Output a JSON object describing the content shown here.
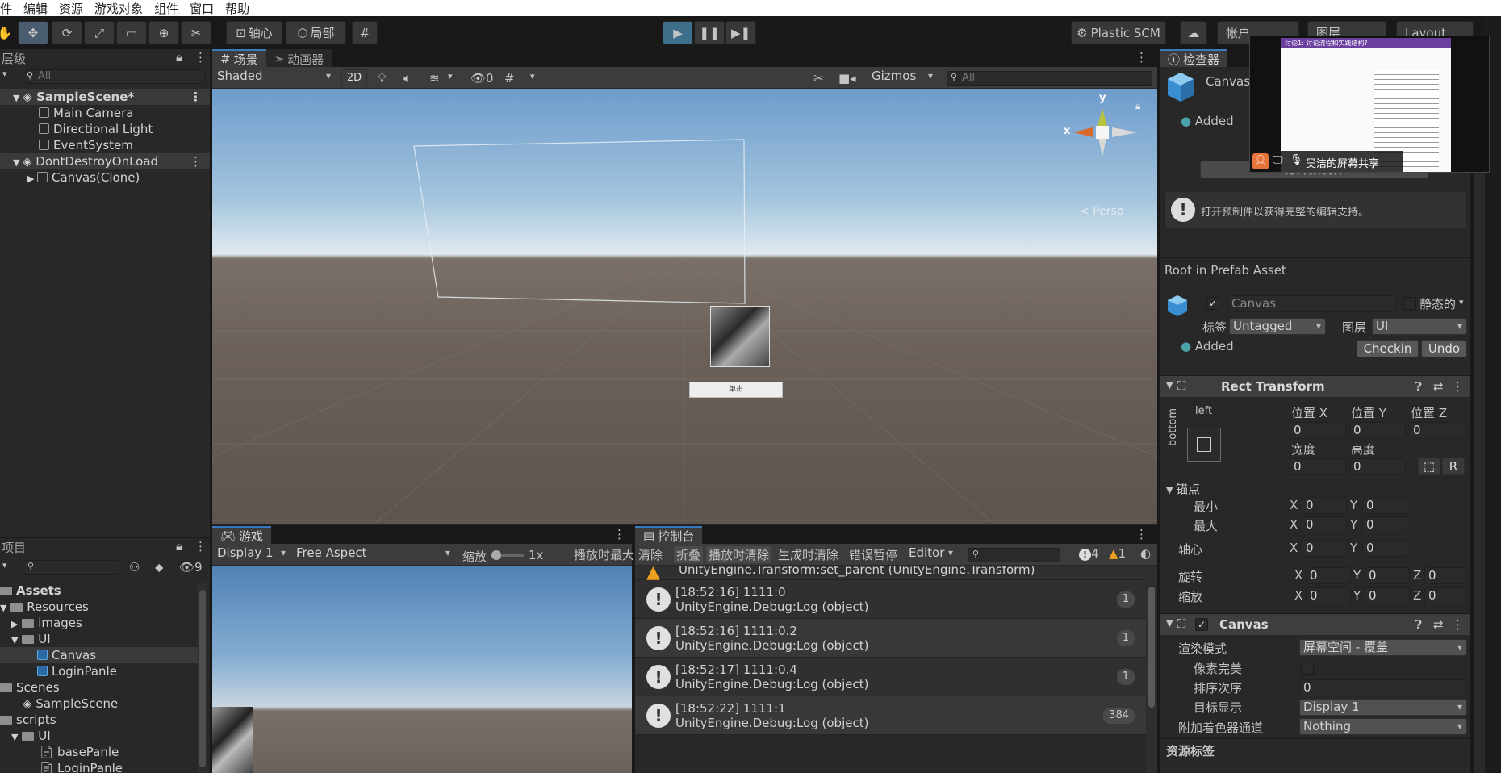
{
  "menu": {
    "items": [
      "件",
      "编辑",
      "资源",
      "游戏对象",
      "组件",
      "窗口",
      "帮助"
    ]
  },
  "toolbar": {
    "pivot": "轴心",
    "local": "局部",
    "plastic": "Plastic SCM",
    "account": "帐户",
    "layers": "图层",
    "layout": "Layout"
  },
  "hierarchy": {
    "tab": "层级",
    "search_placeholder": "All",
    "rows": [
      {
        "label": "SampleScene*",
        "type": "scene"
      },
      {
        "label": "Main Camera",
        "type": "go"
      },
      {
        "label": "Directional Light",
        "type": "go"
      },
      {
        "label": "EventSystem",
        "type": "go"
      },
      {
        "label": "DontDestroyOnLoad",
        "type": "scene"
      },
      {
        "label": "Canvas(Clone)",
        "type": "go"
      }
    ]
  },
  "scene": {
    "tab_scene": "场景",
    "tab_animator": "动画器",
    "shading": "Shaded",
    "mode2d": "2D",
    "hidden_count": "0",
    "gizmos": "Gizmos",
    "search_placeholder": "All",
    "axis_y": "y",
    "axis_x": "x",
    "persp": "< Persp",
    "button_caption": "单击"
  },
  "game": {
    "tab": "游戏",
    "display": "Display 1",
    "aspect": "Free Aspect",
    "scale_label": "缩放",
    "scale_value": "1x",
    "maximize": "播放时最大"
  },
  "console": {
    "tab": "控制台",
    "clear": "清除",
    "collapse": "折叠",
    "clear_on_play": "播放时清除",
    "clear_on_build": "生成时清除",
    "error_pause": "错误暂停",
    "editor": "Editor",
    "count_info": "4",
    "count_warn": "1",
    "top_line": "UnityEngine.Transform:set_parent (UnityEngine.Transform)",
    "rows": [
      {
        "line1": "[18:52:16] 1111:0",
        "line2": "UnityEngine.Debug:Log (object)",
        "count": "1"
      },
      {
        "line1": "[18:52:16] 1111:0.2",
        "line2": "UnityEngine.Debug:Log (object)",
        "count": "1"
      },
      {
        "line1": "[18:52:17] 1111:0.4",
        "line2": "UnityEngine.Debug:Log (object)",
        "count": "1"
      },
      {
        "line1": "[18:52:22] 1111:1",
        "line2": "UnityEngine.Debug:Log (object)",
        "count": "384"
      }
    ]
  },
  "project": {
    "tab": "项目",
    "hidden_count": "9",
    "tree": [
      {
        "label": "Assets",
        "indent": 0,
        "kind": "folder"
      },
      {
        "label": "Resources",
        "indent": 1,
        "kind": "folder"
      },
      {
        "label": "images",
        "indent": 2,
        "kind": "folder"
      },
      {
        "label": "UI",
        "indent": 2,
        "kind": "folder"
      },
      {
        "label": "Canvas",
        "indent": 3,
        "kind": "prefab"
      },
      {
        "label": "LoginPanle",
        "indent": 3,
        "kind": "prefab"
      },
      {
        "label": "Scenes",
        "indent": 0,
        "kind": "folder"
      },
      {
        "label": "SampleScene",
        "indent": 1,
        "kind": "scene"
      },
      {
        "label": "scripts",
        "indent": 0,
        "kind": "folder"
      },
      {
        "label": "UI",
        "indent": 1,
        "kind": "folder"
      },
      {
        "label": "basePanle",
        "indent": 2,
        "kind": "script"
      },
      {
        "label": "LoginPanle",
        "indent": 2,
        "kind": "script"
      }
    ]
  },
  "inspector": {
    "tab": "检查器",
    "object_name": "Canvas",
    "added": "Added",
    "open_prefab_btn": "打开预制件",
    "help_text": "打开预制件以获得完整的编辑支持。",
    "root_label": "Root in Prefab Asset",
    "name_field": "Canvas",
    "static_label": "静态的",
    "tag_label": "标签",
    "tag_value": "Untagged",
    "layer_label": "图层",
    "layer_value": "UI",
    "added2": "Added",
    "checkin": "Checkin",
    "undo": "Undo",
    "rect": {
      "title": "Rect Transform",
      "anchor_h": "left",
      "anchor_v": "bottom",
      "pos_x": "位置 X",
      "pos_y": "位置 Y",
      "pos_z": "位置 Z",
      "width": "宽度",
      "height": "高度",
      "v_px": "0",
      "v_py": "0",
      "v_pz": "0",
      "v_w": "0",
      "v_h": "0",
      "anchors": "锚点",
      "min": "最小",
      "max": "最大",
      "pivot": "轴心",
      "rotation": "旋转",
      "scale": "缩放",
      "x": "X",
      "y": "Y",
      "z": "Z",
      "zero": "0"
    },
    "canvas": {
      "title": "Canvas",
      "render_mode_label": "渲染模式",
      "render_mode": "屏幕空间 - 覆盖",
      "pixel_perfect": "像素完美",
      "sort_order_label": "排序次序",
      "sort_order": "0",
      "target_display_label": "目标显示",
      "target_display": "Display 1",
      "shader_channel_label": "附加着色器通道",
      "shader_channel": "Nothing"
    },
    "asset_label": "资源标签"
  },
  "overlay": {
    "share_label": "吴洁的屏幕共享",
    "doc_title": "讨论1: 讨论流程和实践结构?"
  },
  "colors": {
    "accent": "#3a79bb",
    "play_active": "#3d6f8a",
    "warning": "#f0a020"
  }
}
